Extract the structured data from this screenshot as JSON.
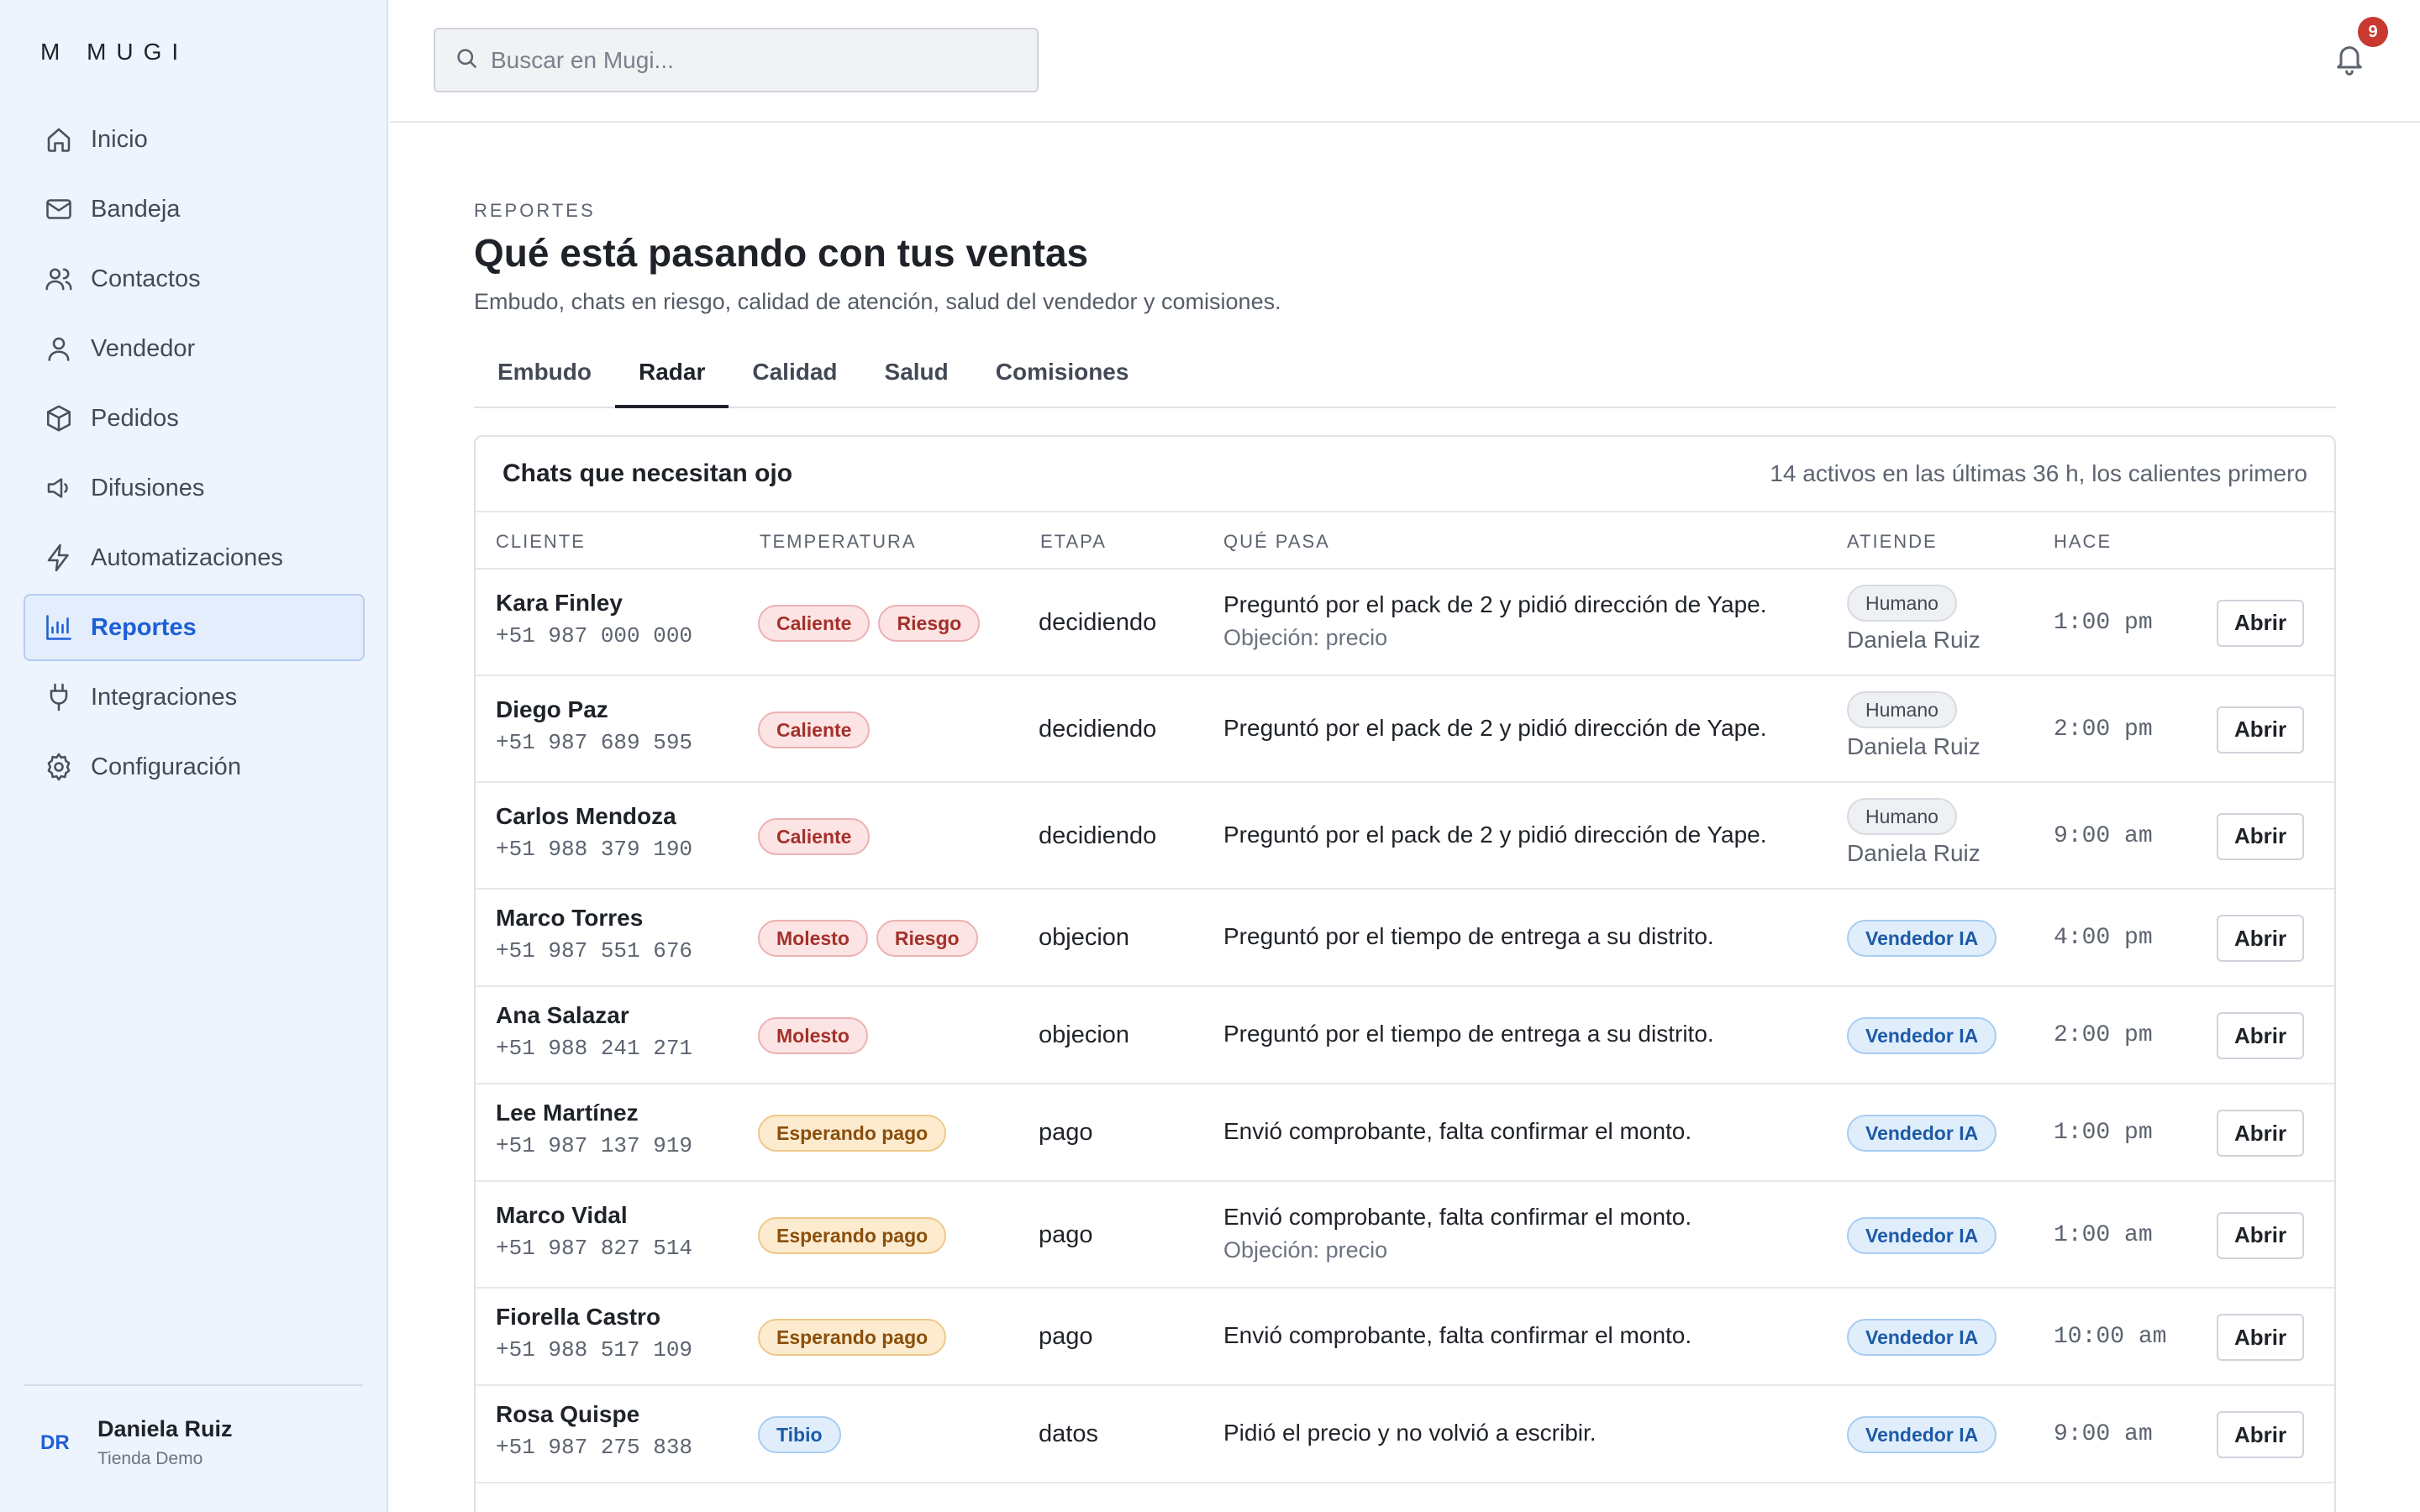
{
  "brand": {
    "logo_text": "M  MUGI"
  },
  "sidebar": {
    "items": [
      {
        "label": "Inicio",
        "icon": "home-icon",
        "active": false
      },
      {
        "label": "Bandeja",
        "icon": "inbox-icon",
        "active": false
      },
      {
        "label": "Contactos",
        "icon": "users-icon",
        "active": false
      },
      {
        "label": "Vendedor",
        "icon": "user-icon",
        "active": false
      },
      {
        "label": "Pedidos",
        "icon": "box-icon",
        "active": false
      },
      {
        "label": "Difusiones",
        "icon": "megaphone-icon",
        "active": false
      },
      {
        "label": "Automatizaciones",
        "icon": "bolt-icon",
        "active": false
      },
      {
        "label": "Reportes",
        "icon": "bar-chart-icon",
        "active": true
      },
      {
        "label": "Integraciones",
        "icon": "plug-icon",
        "active": false
      },
      {
        "label": "Configuración",
        "icon": "gear-icon",
        "active": false
      }
    ],
    "user": {
      "initials": "DR",
      "name": "Daniela Ruiz",
      "store": "Tienda Demo"
    }
  },
  "topbar": {
    "search_placeholder": "Buscar en Mugi...",
    "notifications_count": "9"
  },
  "page": {
    "eyebrow": "REPORTES",
    "title": "Qué está pasando con tus ventas",
    "subtitle": "Embudo, chats en riesgo, calidad de atención, salud del vendedor y comisiones.",
    "tabs": [
      {
        "label": "Embudo",
        "active": false
      },
      {
        "label": "Radar",
        "active": true
      },
      {
        "label": "Calidad",
        "active": false
      },
      {
        "label": "Salud",
        "active": false
      },
      {
        "label": "Comisiones",
        "active": false
      }
    ]
  },
  "radar": {
    "title": "Chats que necesitan ojo",
    "meta": "14 activos en las últimas 36 h, los calientes primero",
    "columns": [
      "CLIENTE",
      "TEMPERATURA",
      "ETAPA",
      "QUÉ PASA",
      "ATIENDE",
      "HACE"
    ],
    "open_label": "Abrir",
    "rows": [
      {
        "name": "Kara Finley",
        "phone": "+51 987 000 000",
        "tags": [
          {
            "label": "Caliente",
            "kind": "hot"
          },
          {
            "label": "Riesgo",
            "kind": "hot"
          }
        ],
        "stage": "decidiendo",
        "what": "Preguntó por el pack de 2 y pidió dirección de Yape.",
        "objection": "Objeción: precio",
        "who": "Humano",
        "who_kind": "human",
        "agent": "Daniela Ruiz",
        "time": "1:00 pm"
      },
      {
        "name": "Diego Paz",
        "phone": "+51 987 689 595",
        "tags": [
          {
            "label": "Caliente",
            "kind": "hot"
          }
        ],
        "stage": "decidiendo",
        "what": "Preguntó por el pack de 2 y pidió dirección de Yape.",
        "objection": "",
        "who": "Humano",
        "who_kind": "human",
        "agent": "Daniela Ruiz",
        "time": "2:00 pm"
      },
      {
        "name": "Carlos Mendoza",
        "phone": "+51 988 379 190",
        "tags": [
          {
            "label": "Caliente",
            "kind": "hot"
          }
        ],
        "stage": "decidiendo",
        "what": "Preguntó por el pack de 2 y pidió dirección de Yape.",
        "objection": "",
        "who": "Humano",
        "who_kind": "human",
        "agent": "Daniela Ruiz",
        "time": "9:00 am"
      },
      {
        "name": "Marco Torres",
        "phone": "+51 987 551 676",
        "tags": [
          {
            "label": "Molesto",
            "kind": "hot"
          },
          {
            "label": "Riesgo",
            "kind": "hot"
          }
        ],
        "stage": "objecion",
        "what": "Preguntó por el tiempo de entrega a su distrito.",
        "objection": "",
        "who": "Vendedor IA",
        "who_kind": "ia",
        "agent": "",
        "time": "4:00 pm"
      },
      {
        "name": "Ana Salazar",
        "phone": "+51 988 241 271",
        "tags": [
          {
            "label": "Molesto",
            "kind": "hot"
          }
        ],
        "stage": "objecion",
        "what": "Preguntó por el tiempo de entrega a su distrito.",
        "objection": "",
        "who": "Vendedor IA",
        "who_kind": "ia",
        "agent": "",
        "time": "2:00 pm"
      },
      {
        "name": "Lee Martínez",
        "phone": "+51 987 137 919",
        "tags": [
          {
            "label": "Esperando pago",
            "kind": "pay"
          }
        ],
        "stage": "pago",
        "what": "Envió comprobante, falta confirmar el monto.",
        "objection": "",
        "who": "Vendedor IA",
        "who_kind": "ia",
        "agent": "",
        "time": "1:00 pm"
      },
      {
        "name": "Marco Vidal",
        "phone": "+51 987 827 514",
        "tags": [
          {
            "label": "Esperando pago",
            "kind": "pay"
          }
        ],
        "stage": "pago",
        "what": "Envió comprobante, falta confirmar el monto.",
        "objection": "Objeción: precio",
        "who": "Vendedor IA",
        "who_kind": "ia",
        "agent": "",
        "time": "1:00 am"
      },
      {
        "name": "Fiorella Castro",
        "phone": "+51 988 517 109",
        "tags": [
          {
            "label": "Esperando pago",
            "kind": "pay"
          }
        ],
        "stage": "pago",
        "what": "Envió comprobante, falta confirmar el monto.",
        "objection": "",
        "who": "Vendedor IA",
        "who_kind": "ia",
        "agent": "",
        "time": "10:00 am"
      },
      {
        "name": "Rosa Quispe",
        "phone": "+51 987 275 838",
        "tags": [
          {
            "label": "Tibio",
            "kind": "warm"
          }
        ],
        "stage": "datos",
        "what": "Pidió el precio y no volvió a escribir.",
        "objection": "",
        "who": "Vendedor IA",
        "who_kind": "ia",
        "agent": "",
        "time": "9:00 am"
      }
    ]
  }
}
